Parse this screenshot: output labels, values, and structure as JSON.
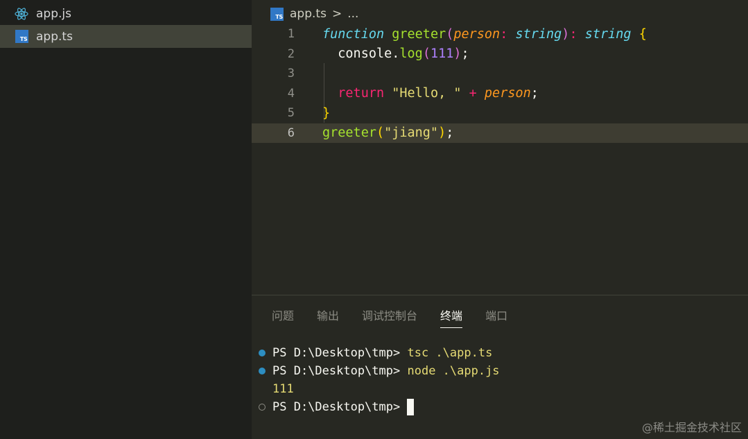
{
  "explorer": {
    "files": [
      {
        "name": "app.js",
        "icon": "react-icon",
        "selected": false
      },
      {
        "name": "app.ts",
        "icon": "typescript-icon",
        "selected": true
      }
    ]
  },
  "editor": {
    "breadcrumb": {
      "file": "app.ts",
      "separator": ">",
      "more": "..."
    },
    "ts_badge": "TS",
    "line_numbers": [
      "1",
      "2",
      "3",
      "4",
      "5",
      "6"
    ],
    "code": {
      "l1": {
        "kw": "function",
        "fn": "greeter",
        "open": "(",
        "param": "person",
        "colon": ":",
        "ptype": "string",
        "close": ")",
        "colon2": ":",
        "rtype": "string",
        "brace": "{"
      },
      "l2": {
        "obj": "console",
        "dot": ".",
        "method": "log",
        "open": "(",
        "num": "111",
        "close": ")",
        "semi": ";"
      },
      "l4": {
        "kw": "return",
        "str": "\"Hello, \"",
        "op": "+",
        "param": "person",
        "semi": ";"
      },
      "l5": {
        "brace": "}"
      },
      "l6": {
        "fn": "greeter",
        "open": "(",
        "str": "\"jiang\"",
        "close": ")",
        "semi": ";"
      }
    }
  },
  "panel": {
    "tabs": [
      "问题",
      "输出",
      "调试控制台",
      "终端",
      "端口"
    ],
    "active_tab": "终端",
    "terminal": [
      {
        "prompt": "PS D:\\Desktop\\tmp>",
        "command": "tsc .\\app.ts",
        "status": "done"
      },
      {
        "prompt": "PS D:\\Desktop\\tmp>",
        "command": "node .\\app.js",
        "status": "done"
      },
      {
        "output": "111"
      },
      {
        "prompt": "PS D:\\Desktop\\tmp>",
        "command": "",
        "status": "idle"
      }
    ]
  },
  "watermark": "@稀土掘金技术社区",
  "colors": {
    "background": "#272822",
    "sidebar": "#1e1f1c",
    "selection": "#414339",
    "keyword": "#66d9ef",
    "function": "#a6e22e",
    "string": "#e6db74",
    "param": "#fd971f",
    "operator": "#f92672"
  }
}
